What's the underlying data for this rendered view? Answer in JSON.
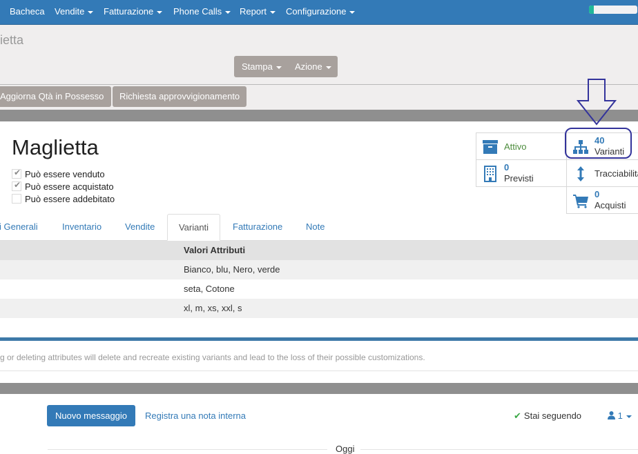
{
  "navbar": {
    "menu": [
      {
        "label": "Bacheca",
        "dropdown": false
      },
      {
        "label": "Vendite",
        "dropdown": true
      },
      {
        "label": "Fatturazione",
        "dropdown": true
      },
      {
        "label": "Phone Calls",
        "dropdown": true
      },
      {
        "label": "Report",
        "dropdown": true
      },
      {
        "label": "Configurazione",
        "dropdown": true
      }
    ],
    "progress_fraction": 0.1,
    "accent": "#337ab7",
    "progress_color": "#21b799"
  },
  "control_panel": {
    "breadcrumb": "ietta",
    "print_label": "Stampa",
    "action_label": "Azione"
  },
  "header_buttons": {
    "update_qty": "Aggiorna Qtà in Possesso",
    "procurement": "Richiesta approvvigionamento"
  },
  "product": {
    "name": "Maglietta",
    "checkboxes": [
      {
        "label": "Può essere venduto",
        "checked": true,
        "mark": "✔"
      },
      {
        "label": "Può essere acquistato",
        "checked": true,
        "mark": "✔"
      },
      {
        "label": "Può essere addebitato",
        "checked": false,
        "mark": ""
      }
    ]
  },
  "smart_buttons": {
    "active": {
      "label": "Attivo",
      "icon": "archive-icon",
      "color": "#4c8c3c"
    },
    "variants": {
      "value": "40",
      "label": "Varianti",
      "icon": "sitemap-icon"
    },
    "forecast": {
      "value": "0",
      "label": "Previsti",
      "icon": "building-icon"
    },
    "traceability": {
      "label": "Tracciabilità",
      "icon": "arrows-vertical-icon"
    },
    "purchases": {
      "value": "0",
      "label": "Acquisti",
      "icon": "shopping-cart-icon"
    }
  },
  "annotation": {
    "color": "#33339b"
  },
  "tabs": [
    {
      "label": "Informazioni Generali",
      "visible_label": "i Generali",
      "active": false
    },
    {
      "label": "Inventario",
      "active": false
    },
    {
      "label": "Vendite",
      "active": false
    },
    {
      "label": "Varianti",
      "active": true
    },
    {
      "label": "Fatturazione",
      "active": false
    },
    {
      "label": "Note",
      "active": false
    }
  ],
  "attributes_table": {
    "columns": [
      "Valori Attributi"
    ],
    "rows": [
      [
        "Bianco, blu, Nero, verde"
      ],
      [
        "seta, Cotone"
      ],
      [
        "xl, m, xs, xxl, s"
      ]
    ]
  },
  "warning": "g or deleting attributes will delete and recreate existing variants and lead to the loss of their possible customizations.",
  "chatter": {
    "new_message": "Nuovo messaggio",
    "log_note": "Registra una nota interna",
    "following": "Stai seguendo",
    "followers_count": "1",
    "date_separator": "Oggi"
  }
}
